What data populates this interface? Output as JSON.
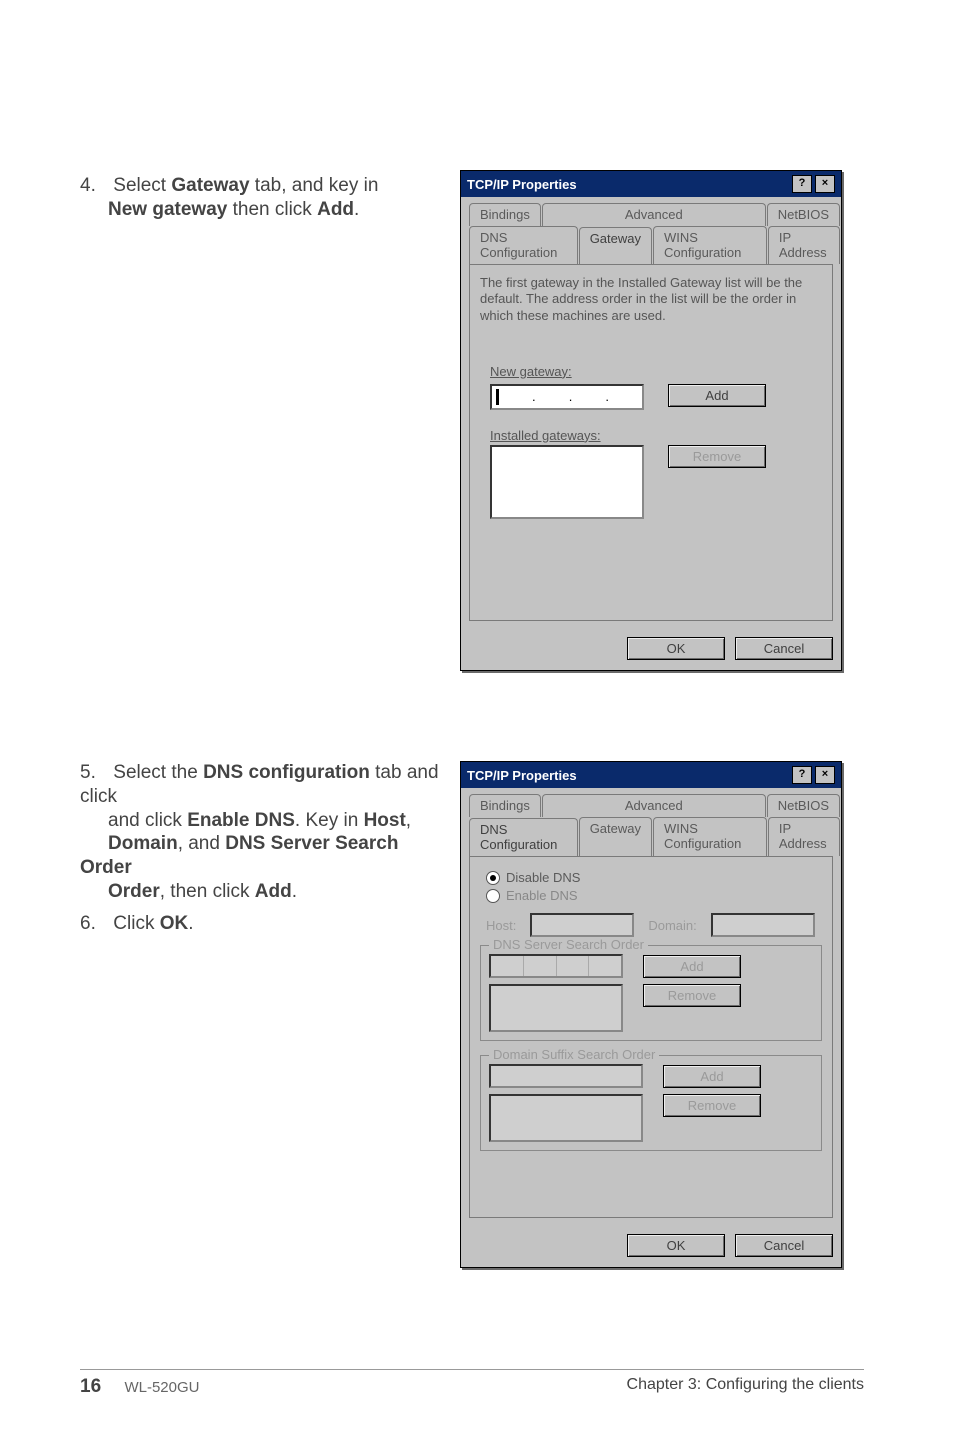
{
  "step4": {
    "num": "4.",
    "line1_a": "Select ",
    "line1_b": "Gateway",
    "line1_c": " tab, and key in ",
    "line2_a": "New gateway",
    "line2_b": " then click ",
    "line2_c": "Add",
    "line2_d": "."
  },
  "step5": {
    "num": "5.",
    "t1": "Select the ",
    "b1": "DNS configuration",
    "t2": " tab and click ",
    "b2": "Enable DNS",
    "t3": ". Key in ",
    "b3": "Host",
    "t4": ", ",
    "b4": "Domain",
    "t5": ", and ",
    "b5": "DNS Server Search Order",
    "t6": ", then click ",
    "b6": "Add",
    "t7": "."
  },
  "step6": {
    "num": "6.",
    "t1": "Click ",
    "b1": "OK",
    "t2": "."
  },
  "dlg1": {
    "title": "TCP/IP Properties",
    "help": "?",
    "close": "×",
    "tabs_row1": {
      "bindings": "Bindings",
      "advanced": "Advanced",
      "netbios": "NetBIOS"
    },
    "tabs_row2": {
      "dnsconf": "DNS Configuration",
      "gateway": "Gateway",
      "winsconf": "WINS Configuration",
      "ip": "IP Address"
    },
    "info": "The first gateway in the Installed Gateway list will be the default. The address order in the list will be the order in which these machines are used.",
    "newgw_label": "New gateway:",
    "add": "Add",
    "installed_label": "Installed gateways:",
    "remove": "Remove",
    "ok": "OK",
    "cancel": "Cancel"
  },
  "dlg2": {
    "title": "TCP/IP Properties",
    "help": "?",
    "close": "×",
    "tabs_row1": {
      "bindings": "Bindings",
      "advanced": "Advanced",
      "netbios": "NetBIOS"
    },
    "tabs_row2": {
      "dnsconf": "DNS Configuration",
      "gateway": "Gateway",
      "winsconf": "WINS Configuration",
      "ip": "IP Address"
    },
    "disable": "Disable DNS",
    "enable": "Enable DNS",
    "host": "Host:",
    "domain": "Domain:",
    "serverorder": "DNS Server Search Order",
    "suffixorder": "Domain Suffix Search Order",
    "add": "Add",
    "remove": "Remove",
    "ok": "OK",
    "cancel": "Cancel"
  },
  "footer": {
    "page": "16",
    "model": "WL-520GU",
    "chapter": "Chapter 3: Configuring the clients"
  }
}
